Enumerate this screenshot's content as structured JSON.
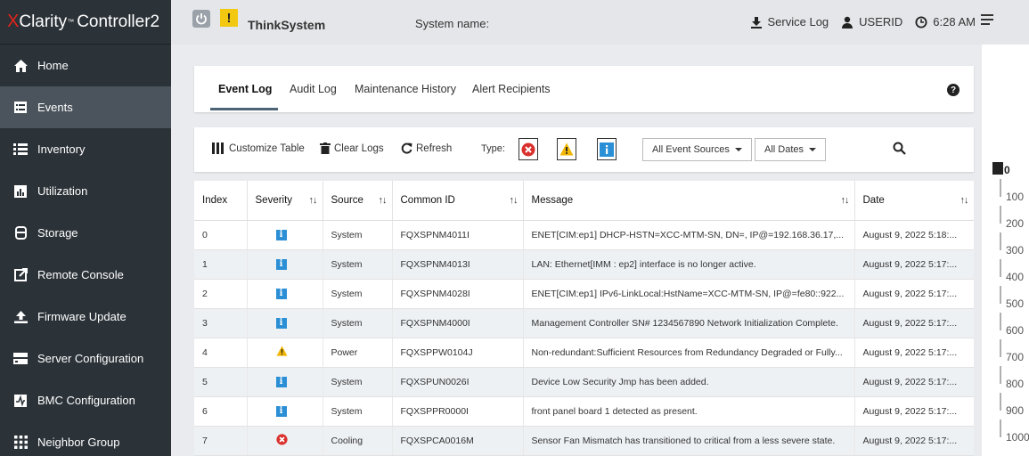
{
  "brand": {
    "x": "X",
    "name": "Clarity",
    "tm": "™",
    "product": "Controller2"
  },
  "sidebar": {
    "items": [
      {
        "label": "Home",
        "icon": "home-icon"
      },
      {
        "label": "Events",
        "icon": "events-icon",
        "active": true
      },
      {
        "label": "Inventory",
        "icon": "inventory-icon"
      },
      {
        "label": "Utilization",
        "icon": "utilization-icon"
      },
      {
        "label": "Storage",
        "icon": "storage-icon"
      },
      {
        "label": "Remote Console",
        "icon": "remote-console-icon"
      },
      {
        "label": "Firmware Update",
        "icon": "firmware-update-icon"
      },
      {
        "label": "Server Configuration",
        "icon": "server-configuration-icon"
      },
      {
        "label": "BMC Configuration",
        "icon": "bmc-configuration-icon"
      },
      {
        "label": "Neighbor Group",
        "icon": "neighbor-group-icon"
      }
    ]
  },
  "header": {
    "warning_mark": "!",
    "system": "ThinkSystem",
    "system_name_label": "System name:",
    "service_log": "Service Log",
    "user": "USERID",
    "time": "6:28 AM"
  },
  "tabs": [
    {
      "label": "Event Log",
      "active": true
    },
    {
      "label": "Audit Log"
    },
    {
      "label": "Maintenance History"
    },
    {
      "label": "Alert Recipients"
    }
  ],
  "help": "?",
  "toolbar": {
    "customize": "Customize Table",
    "clear": "Clear Logs",
    "refresh": "Refresh",
    "type_label": "Type:",
    "sources": "All Event Sources",
    "dates": "All Dates"
  },
  "table": {
    "columns": [
      "Index",
      "Severity",
      "Source",
      "Common ID",
      "Message",
      "Date"
    ],
    "sort_glyph": "↑↓",
    "info_glyph": "i",
    "rows": [
      {
        "index": "0",
        "severity": "info",
        "source": "System",
        "id": "FQXSPNM4011I",
        "message": "ENET[CIM:ep1] DHCP-HSTN=XCC-MTM-SN, DN=, IP@=192.168.36.17,...",
        "date": "August 9, 2022 5:18:..."
      },
      {
        "index": "1",
        "severity": "info",
        "source": "System",
        "id": "FQXSPNM4013I",
        "message": "LAN: Ethernet[IMM : ep2] interface is no longer active.",
        "date": "August 9, 2022 5:17:..."
      },
      {
        "index": "2",
        "severity": "info",
        "source": "System",
        "id": "FQXSPNM4028I",
        "message": "ENET[CIM:ep1] IPv6-LinkLocal:HstName=XCC-MTM-SN, IP@=fe80::922...",
        "date": "August 9, 2022 5:17:..."
      },
      {
        "index": "3",
        "severity": "info",
        "source": "System",
        "id": "FQXSPNM4000I",
        "message": "Management Controller SN# 1234567890 Network Initialization Complete.",
        "date": "August 9, 2022 5:17:..."
      },
      {
        "index": "4",
        "severity": "warning",
        "source": "Power",
        "id": "FQXSPPW0104J",
        "message": "Non-redundant:Sufficient Resources from Redundancy Degraded or Fully...",
        "date": "August 9, 2022 5:17:..."
      },
      {
        "index": "5",
        "severity": "info",
        "source": "System",
        "id": "FQXSPUN0026I",
        "message": "Device Low Security Jmp has been added.",
        "date": "August 9, 2022 5:17:..."
      },
      {
        "index": "6",
        "severity": "info",
        "source": "System",
        "id": "FQXSPPR0000I",
        "message": "front panel board 1 detected as present.",
        "date": "August 9, 2022 5:17:..."
      },
      {
        "index": "7",
        "severity": "error",
        "source": "Cooling",
        "id": "FQXSPCA0016M",
        "message": "Sensor Fan Mismatch has transitioned to critical from a less severe state.",
        "date": "August 9, 2022 5:17:..."
      }
    ]
  },
  "scale": {
    "labels": [
      "0",
      "100",
      "200",
      "300",
      "400",
      "500",
      "600",
      "700",
      "800",
      "900",
      "1000"
    ]
  },
  "colors": {
    "sidebar": "#2b3238",
    "active": "#4b545c",
    "info": "#2b8fd6",
    "warning": "#f2c811",
    "error": "#d9302c",
    "brand_red": "#e2231a"
  }
}
